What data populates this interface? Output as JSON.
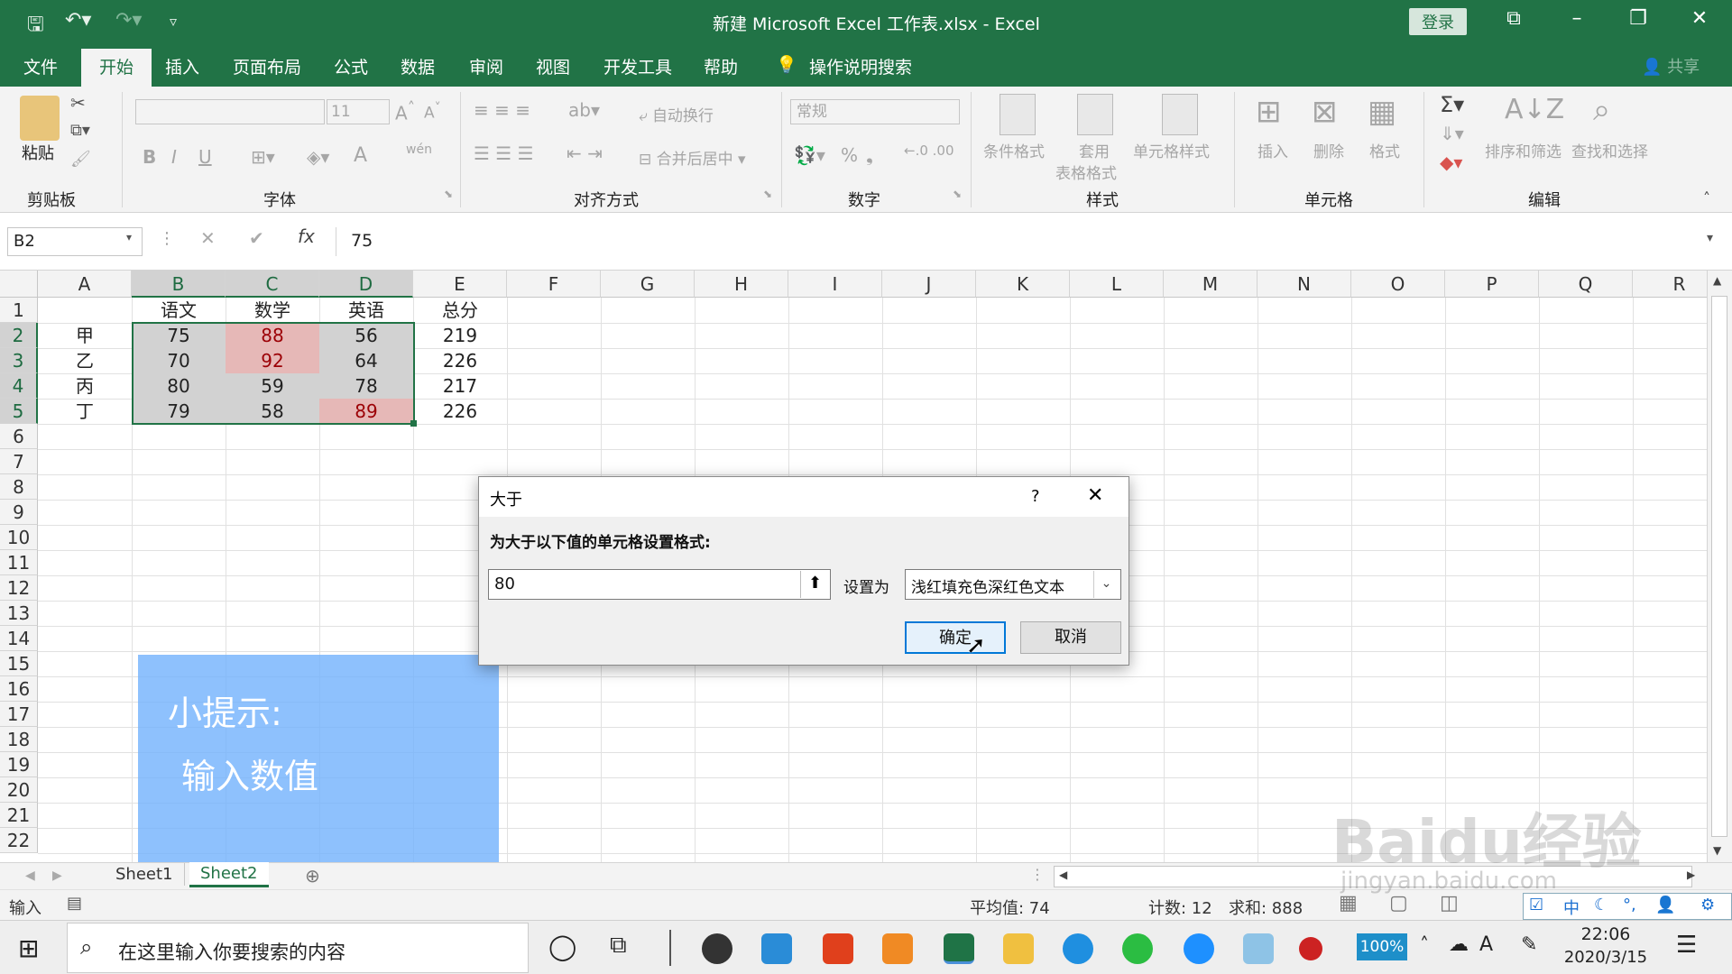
{
  "titlebar": {
    "title": "新建 Microsoft Excel 工作表.xlsx  -  Excel",
    "login": "登录"
  },
  "menu": {
    "tabs": [
      "文件",
      "开始",
      "插入",
      "页面布局",
      "公式",
      "数据",
      "审阅",
      "视图",
      "开发工具",
      "帮助"
    ],
    "search": "操作说明搜索",
    "share": "共享"
  },
  "ribbon": {
    "clipboard": {
      "paste": "粘贴",
      "group": "剪贴板"
    },
    "font": {
      "size": "11",
      "bold": "B",
      "italic": "I",
      "underline": "U",
      "color_a": "A",
      "wen": "wén",
      "group": "字体"
    },
    "alignment": {
      "wrap": "自动换行",
      "merge": "合并后居中",
      "group": "对齐方式"
    },
    "number": {
      "format": "常规",
      "percent": "%",
      "group": "数字"
    },
    "styles": {
      "conditional": "条件格式",
      "table": "套用",
      "table2": "表格格式",
      "cell": "单元格样式",
      "group": "样式"
    },
    "cells": {
      "insert": "插入",
      "delete": "删除",
      "format": "格式",
      "group": "单元格"
    },
    "editing": {
      "sort": "排序和筛选",
      "find": "查找和选择",
      "group": "编辑"
    }
  },
  "formula_bar": {
    "name_box": "B2",
    "fx": "fx",
    "value": "75"
  },
  "columns": [
    "A",
    "B",
    "C",
    "D",
    "E",
    "F",
    "G",
    "H",
    "I",
    "J",
    "K",
    "L",
    "M",
    "N",
    "O",
    "P",
    "Q",
    "R"
  ],
  "rows": [
    "1",
    "2",
    "3",
    "4",
    "5",
    "6",
    "7",
    "8",
    "9",
    "10",
    "11",
    "12",
    "13",
    "14",
    "15",
    "16",
    "17",
    "18",
    "19",
    "20",
    "21",
    "22"
  ],
  "table": {
    "headers": [
      "语文",
      "数学",
      "英语",
      "总分"
    ],
    "names": [
      "甲",
      "乙",
      "丙",
      "丁"
    ],
    "data": [
      [
        "75",
        "88",
        "56",
        "219"
      ],
      [
        "70",
        "92",
        "64",
        "226"
      ],
      [
        "80",
        "59",
        "78",
        "217"
      ],
      [
        "79",
        "58",
        "89",
        "226"
      ]
    ]
  },
  "dialog": {
    "title": "大于",
    "help": "?",
    "instruction": "为大于以下值的单元格设置格式:",
    "value": "80",
    "set_as": "设置为",
    "format": "浅红填充色深红色文本",
    "ok": "确定",
    "cancel": "取消"
  },
  "tip": {
    "line1": "小提示:",
    "line2": "输入数值"
  },
  "sheets": [
    "Sheet1",
    "Sheet2"
  ],
  "status": {
    "mode": "输入",
    "average": "平均值: 74",
    "count": "计数: 12",
    "sum": "求和: 888"
  },
  "taskbar": {
    "search_placeholder": "在这里输入你要搜索的内容",
    "battery": "100%",
    "ime": "中",
    "time": "22:06",
    "date": "2020/3/15"
  },
  "watermark": {
    "text": "Baidu经验",
    "url": "jingyan.baidu.com"
  },
  "colors": {
    "excel_green": "#217346",
    "bad_fill": "#e6b8b7",
    "bad_text": "#9c0006",
    "tip_blue": "#6eb0fc"
  }
}
